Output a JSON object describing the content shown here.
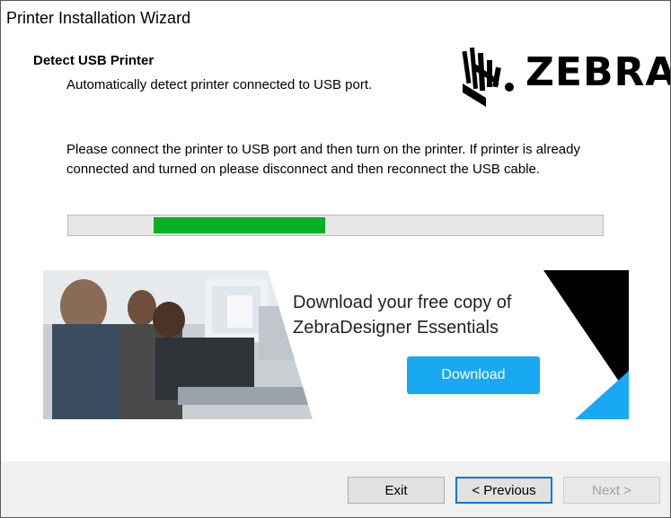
{
  "window": {
    "title": "Printer Installation Wizard"
  },
  "header": {
    "title": "Detect USB Printer",
    "subtitle": "Automatically detect printer connected to USB port.",
    "logo_text": "ZEBRA"
  },
  "instructions": "Please connect the printer to USB port and then turn on the printer. If printer is already connected and turned on please disconnect and then reconnect the USB cable.",
  "progress": {
    "fill_start_fraction": 0.16,
    "fill_end_fraction": 0.48,
    "color": "#06b025"
  },
  "banner": {
    "heading_line1": "Download your free copy of",
    "heading_line2": "ZebraDesigner Essentials",
    "button_label": "Download",
    "accent_color": "#18a9f2"
  },
  "footer": {
    "exit_label": "Exit",
    "previous_label": "< Previous",
    "next_label": "Next >"
  }
}
